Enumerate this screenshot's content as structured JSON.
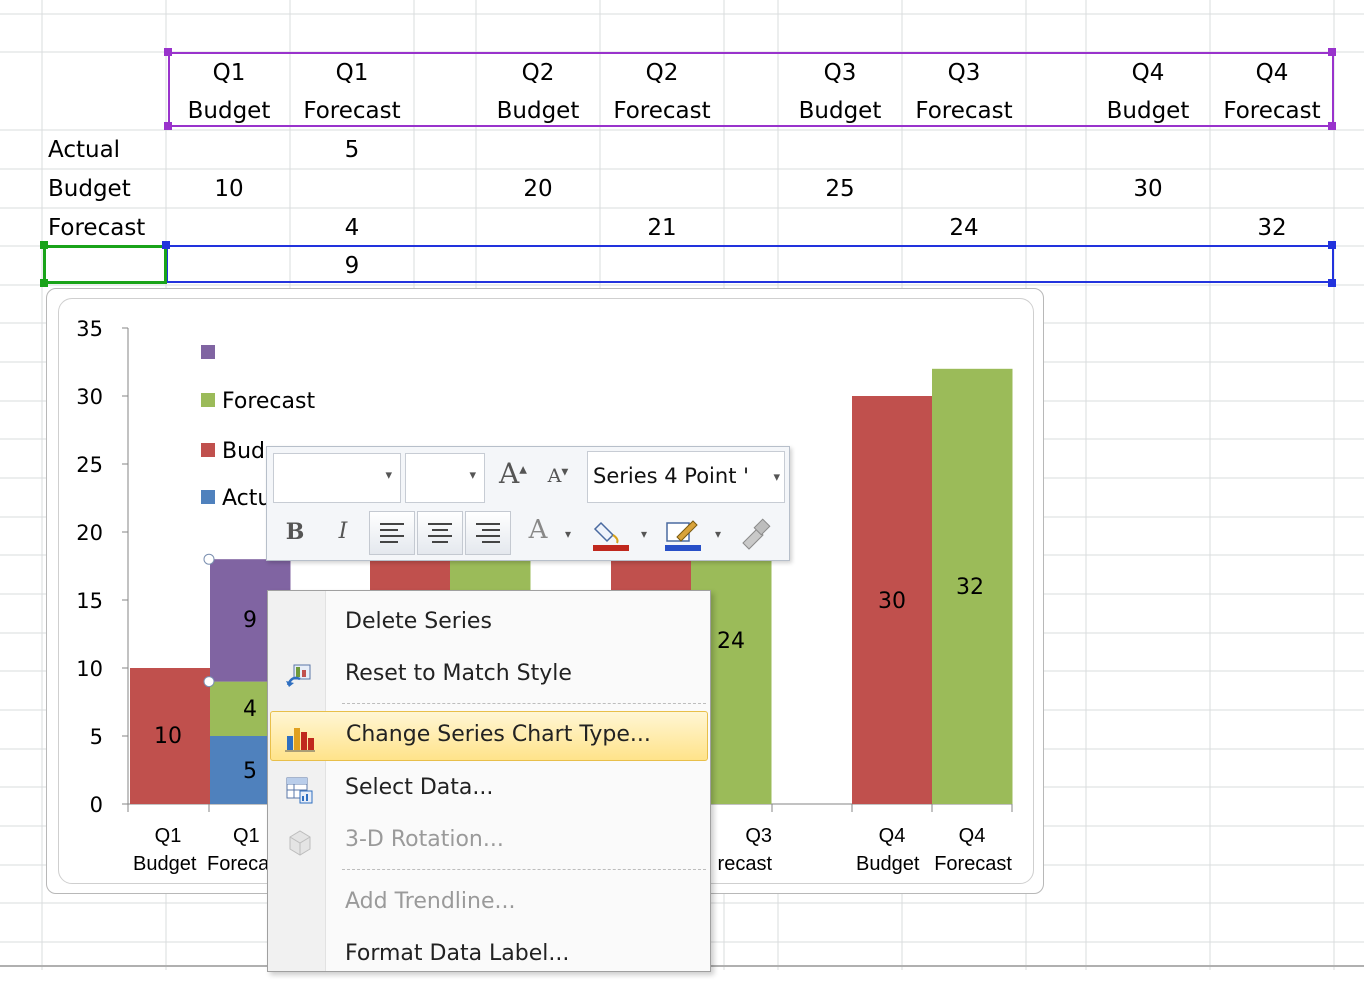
{
  "sheet": {
    "headers": [
      {
        "line1": "Q1",
        "line2": "Budget"
      },
      {
        "line1": "Q1",
        "line2": "Forecast"
      },
      {
        "line1": "Q2",
        "line2": "Budget"
      },
      {
        "line1": "Q2",
        "line2": "Forecast"
      },
      {
        "line1": "Q3",
        "line2": "Budget"
      },
      {
        "line1": "Q3",
        "line2": "Forecast"
      },
      {
        "line1": "Q4",
        "line2": "Budget"
      },
      {
        "line1": "Q4",
        "line2": "Forecast"
      }
    ],
    "rows": [
      {
        "label": "Actual",
        "values": [
          "",
          "5",
          "",
          "",
          "",
          "",
          "",
          ""
        ]
      },
      {
        "label": "Budget",
        "values": [
          "10",
          "",
          "20",
          "",
          "25",
          "",
          "30",
          ""
        ]
      },
      {
        "label": "Forecast",
        "values": [
          "",
          "4",
          "",
          "21",
          "",
          "24",
          "",
          "32"
        ]
      },
      {
        "label": "",
        "values": [
          "",
          "9",
          "",
          "",
          "",
          "",
          "",
          ""
        ]
      }
    ]
  },
  "chart_data": {
    "type": "bar",
    "stacked": true,
    "categories": [
      "Q1 Budget",
      "Q1 Forecast",
      "Q2 Budget",
      "Q2 Forecast",
      "Q3 Budget",
      "Q3 Forecast",
      "Q4 Budget",
      "Q4 Forecast"
    ],
    "series": [
      {
        "name": "Actual",
        "color": "#4f81bd",
        "values": [
          0,
          5,
          0,
          0,
          0,
          0,
          0,
          0
        ]
      },
      {
        "name": "Budget",
        "color": "#c0504d",
        "values": [
          10,
          0,
          20,
          0,
          25,
          0,
          30,
          0
        ]
      },
      {
        "name": "Forecast",
        "color": "#9bbb59",
        "values": [
          0,
          4,
          0,
          21,
          0,
          24,
          0,
          32
        ]
      },
      {
        "name": "",
        "color": "#8064a2",
        "values": [
          0,
          9,
          0,
          0,
          0,
          0,
          0,
          0
        ]
      }
    ],
    "ylim": [
      0,
      35
    ],
    "yticks": [
      "0",
      "5",
      "10",
      "15",
      "20",
      "25",
      "30",
      "35"
    ],
    "visible_category_labels": [
      {
        "l1": "Q1",
        "l2": "Budget"
      },
      {
        "l1": "Q1",
        "l2": "Foreca"
      },
      {
        "l1": "Q3",
        "l2": "recast"
      },
      {
        "l1": "Q4",
        "l2": "Budget"
      },
      {
        "l1": "Q4",
        "l2": "Forecast"
      }
    ],
    "legend_visible": [
      "",
      "Forecast",
      "Bud",
      "Actu"
    ],
    "data_labels_visible": [
      "10",
      "5",
      "4",
      "9",
      "24",
      "30",
      "32"
    ]
  },
  "mini_toolbar": {
    "series_name": "Series 4 Point '",
    "grow_font": "A",
    "shrink_font": "A",
    "bold": "B",
    "italic": "I",
    "font_color": "A"
  },
  "context_menu": {
    "items": [
      {
        "label": "Delete Series",
        "enabled": true
      },
      {
        "label": "Reset to Match Style",
        "enabled": true
      },
      {
        "label": "Change Series Chart Type...",
        "enabled": true
      },
      {
        "label": "Select Data...",
        "enabled": true
      },
      {
        "label": "3-D Rotation...",
        "enabled": false
      },
      {
        "label": "Add Trendline...",
        "enabled": false
      },
      {
        "label": "Format Data Label...",
        "enabled": true
      }
    ]
  }
}
